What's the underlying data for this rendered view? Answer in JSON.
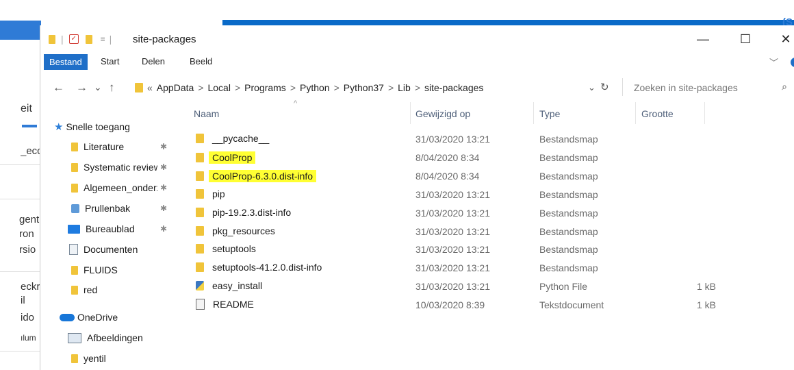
{
  "background": {
    "texts": [
      "eit",
      "_ecc",
      "gent",
      "ron",
      "rsio",
      "eckr",
      "il",
      "ido",
      "ılum"
    ],
    "corner": "(S"
  },
  "window": {
    "title": "site-packages",
    "qa_separator": "=",
    "controls": {
      "minimize": "—",
      "maximize": "☐",
      "close": "✕"
    }
  },
  "ribbon": {
    "tabs": [
      "Bestand",
      "Start",
      "Delen",
      "Beeld"
    ],
    "expand": "﹀"
  },
  "address": {
    "back": "←",
    "forward": "→",
    "recent": "⌄",
    "up": "↑",
    "overflow": "«",
    "crumbs": [
      "AppData",
      "Local",
      "Programs",
      "Python",
      "Python37",
      "Lib",
      "site-packages"
    ],
    "separator": ">",
    "dropdown": "⌄",
    "refresh": "↻"
  },
  "search": {
    "placeholder": "Zoeken in site-packages",
    "icon": "⌕"
  },
  "nav": {
    "quick_access": "Snelle toegang",
    "pinned": [
      {
        "label": "Literature",
        "icon": "folder-icon"
      },
      {
        "label": "Systematic review",
        "icon": "folder-icon"
      },
      {
        "label": "Algemeen_onderzoek",
        "icon": "folder-icon"
      },
      {
        "label": "Prullenbak",
        "icon": "recycle-bin-icon"
      },
      {
        "label": "Bureaublad",
        "icon": "desktop-icon"
      }
    ],
    "other": [
      {
        "label": "Documenten",
        "icon": "documents-icon"
      },
      {
        "label": "FLUIDS",
        "icon": "folder-icon"
      },
      {
        "label": "red",
        "icon": "folder-icon"
      }
    ],
    "onedrive": "OneDrive",
    "onedrive_items": [
      {
        "label": "Afbeeldingen",
        "icon": "pictures-icon"
      },
      {
        "label": "yentil",
        "icon": "folder-icon"
      }
    ],
    "pin_glyph": "📌"
  },
  "columns": {
    "name": "Naam",
    "modified": "Gewijzigd op",
    "type": "Type",
    "size": "Grootte",
    "sort_caret": "^"
  },
  "files": [
    {
      "name": "__pycache__",
      "modified": "31/03/2020 13:21",
      "type": "Bestandsmap",
      "size": "",
      "icon": "folder-icon",
      "highlight": false
    },
    {
      "name": "CoolProp",
      "modified": "8/04/2020 8:34",
      "type": "Bestandsmap",
      "size": "",
      "icon": "folder-icon",
      "highlight": true
    },
    {
      "name": "CoolProp-6.3.0.dist-info",
      "modified": "8/04/2020 8:34",
      "type": "Bestandsmap",
      "size": "",
      "icon": "folder-icon",
      "highlight": true
    },
    {
      "name": "pip",
      "modified": "31/03/2020 13:21",
      "type": "Bestandsmap",
      "size": "",
      "icon": "folder-icon",
      "highlight": false
    },
    {
      "name": "pip-19.2.3.dist-info",
      "modified": "31/03/2020 13:21",
      "type": "Bestandsmap",
      "size": "",
      "icon": "folder-icon",
      "highlight": false
    },
    {
      "name": "pkg_resources",
      "modified": "31/03/2020 13:21",
      "type": "Bestandsmap",
      "size": "",
      "icon": "folder-icon",
      "highlight": false
    },
    {
      "name": "setuptools",
      "modified": "31/03/2020 13:21",
      "type": "Bestandsmap",
      "size": "",
      "icon": "folder-icon",
      "highlight": false
    },
    {
      "name": "setuptools-41.2.0.dist-info",
      "modified": "31/03/2020 13:21",
      "type": "Bestandsmap",
      "size": "",
      "icon": "folder-icon",
      "highlight": false
    },
    {
      "name": "easy_install",
      "modified": "31/03/2020 13:21",
      "type": "Python File",
      "size": "1 kB",
      "icon": "python-file-icon",
      "highlight": false
    },
    {
      "name": "README",
      "modified": "10/03/2020 8:39",
      "type": "Tekstdocument",
      "size": "1 kB",
      "icon": "text-file-icon",
      "highlight": false
    }
  ]
}
